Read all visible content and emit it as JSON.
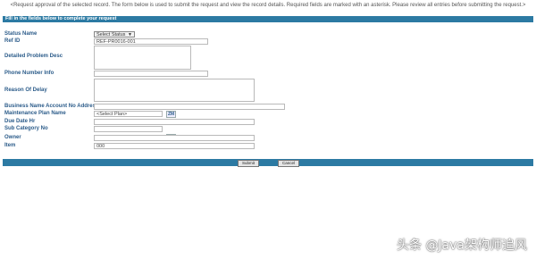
{
  "notice": "<Request approval of the selected record. The form below is used to submit the request and view the record details. Required fields are marked with an asterisk. Please review all entries before submitting the request.>",
  "header": {
    "title": "Fill in the fields below to complete your request"
  },
  "labels": {
    "status": "Status Name",
    "ref": "Ref ID",
    "desc": "Detailed Problem Desc",
    "phone": "Phone Number Info",
    "reason": "Reason Of Delay",
    "account": "Business Name Account No Address",
    "plan": "Maintenance Plan Name",
    "due": "Due Date Hr",
    "sub": "Sub Category No",
    "owner": "Owner",
    "item": "Item"
  },
  "values": {
    "status_select": "Select Status",
    "ref": "REF-PR0016-001",
    "plan": "<Select Plan>",
    "item": "000"
  },
  "pickers": {
    "plan": "ZM",
    "sub": "ZM"
  },
  "buttons": {
    "submit": "Submit",
    "cancel": "Cancel"
  },
  "watermark": "头条 @Java架构师追风"
}
